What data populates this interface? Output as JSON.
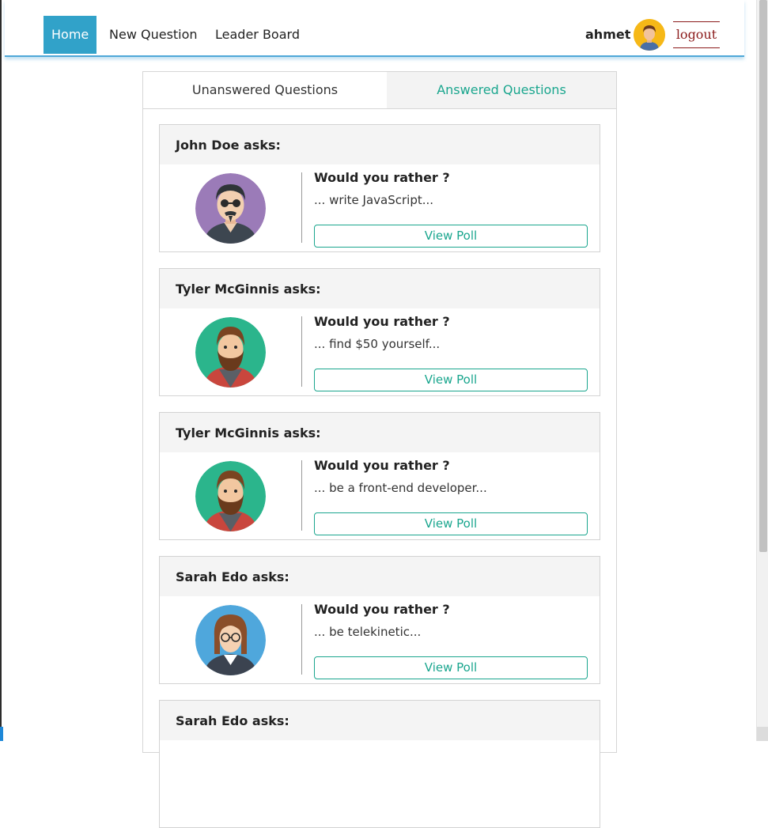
{
  "nav": {
    "items": [
      {
        "label": "Home",
        "active": true
      },
      {
        "label": "New Question",
        "active": false
      },
      {
        "label": "Leader Board",
        "active": false
      }
    ],
    "username": "ahmet",
    "logout_label": "logout"
  },
  "tabs": [
    {
      "label": "Unanswered Questions",
      "active": true
    },
    {
      "label": "Answered Questions",
      "active": false
    }
  ],
  "questions": [
    {
      "author_heading": "John Doe asks:",
      "prompt": "Would you rather ?",
      "option_preview": "... write JavaScript...",
      "button_label": "View Poll",
      "avatar_icon": "man-glasses-avatar-icon"
    },
    {
      "author_heading": "Tyler McGinnis asks:",
      "prompt": "Would you rather ?",
      "option_preview": "... find $50 yourself...",
      "button_label": "View Poll",
      "avatar_icon": "bearded-man-avatar-icon"
    },
    {
      "author_heading": "Tyler McGinnis asks:",
      "prompt": "Would you rather ?",
      "option_preview": "... be a front-end developer...",
      "button_label": "View Poll",
      "avatar_icon": "bearded-man-avatar-icon"
    },
    {
      "author_heading": "Sarah Edo asks:",
      "prompt": "Would you rather ?",
      "option_preview": "... be telekinetic...",
      "button_label": "View Poll",
      "avatar_icon": "woman-glasses-avatar-icon"
    },
    {
      "author_heading": "Sarah Edo asks:",
      "prompt": "",
      "option_preview": "",
      "button_label": "",
      "avatar_icon": ""
    }
  ],
  "colors": {
    "active_nav": "#31a2c9",
    "accent_teal": "#1aa68e",
    "logout": "#8b1a1a",
    "nav_border": "#4fa8d8"
  }
}
